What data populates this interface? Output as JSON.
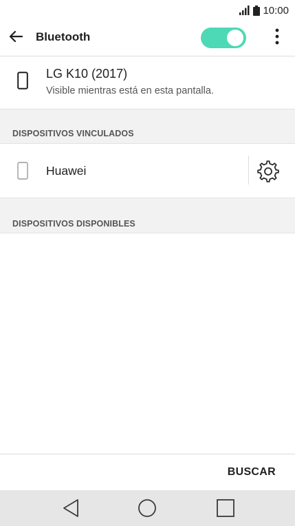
{
  "status_bar": {
    "time": "10:00",
    "signal_icon": "signal-icon",
    "battery_icon": "battery-icon"
  },
  "toolbar": {
    "title": "Bluetooth",
    "back_icon": "arrow-left-icon",
    "toggle_on": true,
    "toggle_color": "#4dd9b5",
    "more_icon": "more-vertical-icon"
  },
  "this_device": {
    "name": "LG K10 (2017)",
    "status": "Visible mientras está en esta pantalla.",
    "icon": "phone-icon"
  },
  "sections": {
    "paired_header": "DISPOSITIVOS VINCULADOS",
    "available_header": "DISPOSITIVOS DISPONIBLES"
  },
  "paired_devices": [
    {
      "name": "Huawei",
      "icon": "phone-icon",
      "settings_icon": "gear-icon"
    }
  ],
  "bottom_bar": {
    "search_label": "BUSCAR"
  },
  "nav_bar": {
    "back_icon": "triangle-back-icon",
    "home_icon": "circle-home-icon",
    "recents_icon": "square-recents-icon"
  }
}
